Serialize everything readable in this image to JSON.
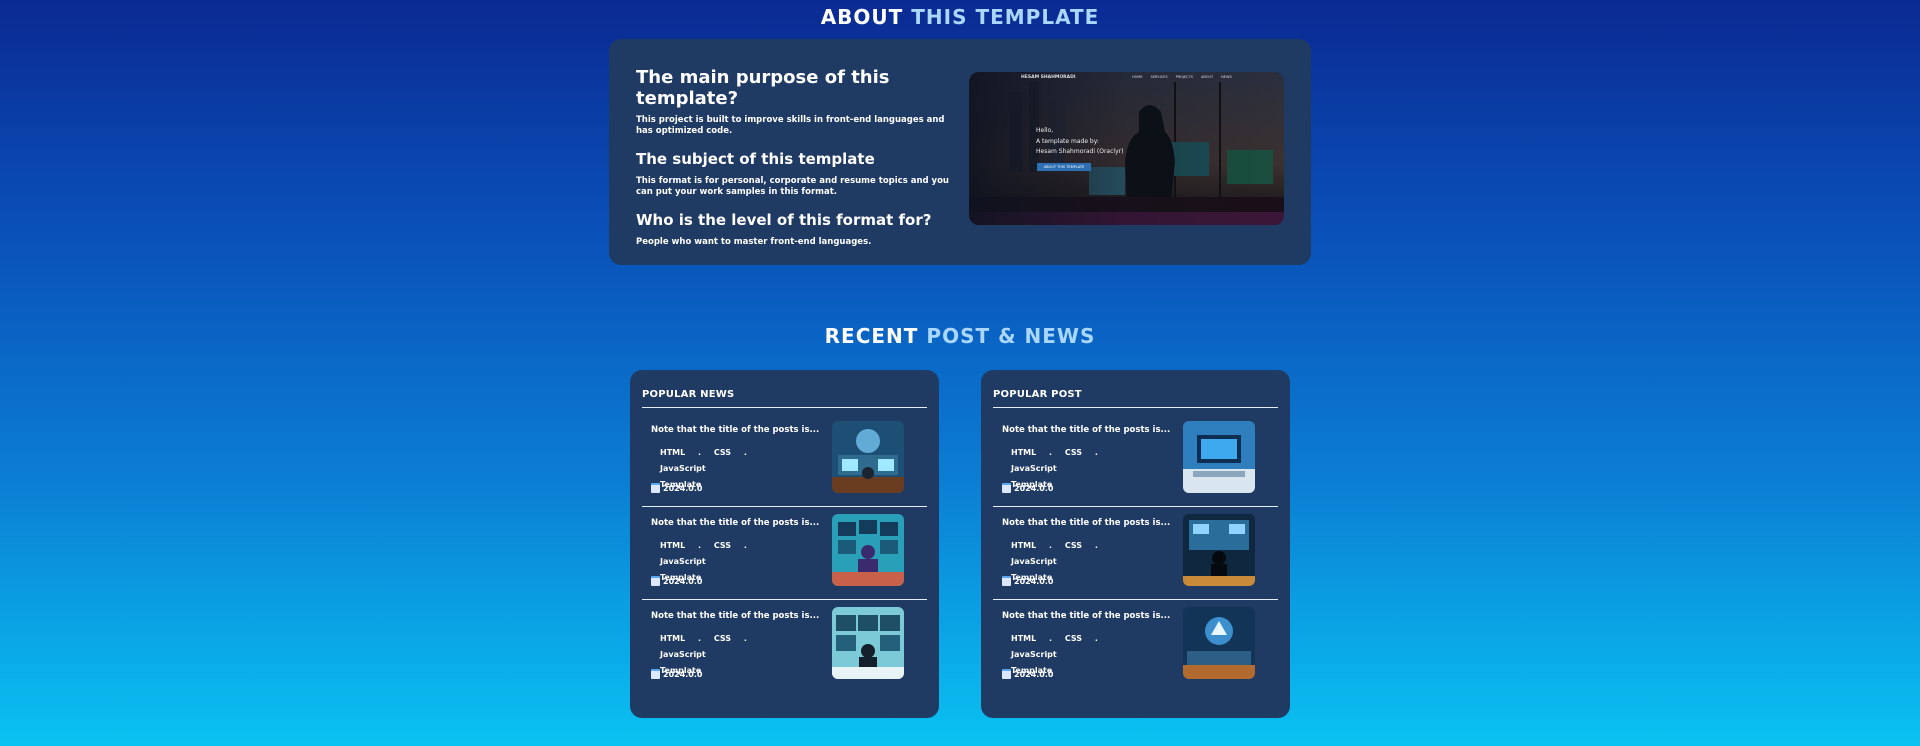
{
  "about": {
    "title_part1": "ABOUT",
    "title_part2": "THIS TEMPLATE",
    "q1": "The main purpose of this template?",
    "a1": "This project is built to improve skills in front-end languages and has optimized code.",
    "q2": "The subject of this template",
    "a2": "This format is for personal, corporate and resume topics and you can put your work samples in this format.",
    "q3": "Who is the level of this format for?",
    "a3": "People who want to master front-end languages.",
    "preview": {
      "brand": "HESAM SHAHMORADI",
      "nav": [
        "HOME",
        "SERVICES",
        "PROJECTS",
        "ABOUT",
        "NEWS"
      ],
      "hello": "Hello,",
      "made_by": "A template made by:",
      "author": "Hesam Shahmoradi (Oraclyr)",
      "button": "ABOUT THIS TEMPLATE"
    }
  },
  "recent": {
    "title_part1": "RECENT",
    "title_part2": "POST & NEWS"
  },
  "news": {
    "title": "POPULAR NEWS",
    "items": [
      {
        "title": "Note that the title of the posts is...",
        "tags": [
          "HTML",
          "CSS",
          "JavaScript"
        ],
        "extra": "Template",
        "date": "2024.0.0"
      },
      {
        "title": "Note that the title of the posts is...",
        "tags": [
          "HTML",
          "CSS",
          "JavaScript"
        ],
        "extra": "Template",
        "date": "2024.0.0"
      },
      {
        "title": "Note that the title of the posts is...",
        "tags": [
          "HTML",
          "CSS",
          "JavaScript"
        ],
        "extra": "Template",
        "date": "2024.0.0"
      }
    ]
  },
  "posts": {
    "title": "POPULAR POST",
    "items": [
      {
        "title": "Note that the title of the posts is...",
        "tags": [
          "HTML",
          "CSS",
          "JavaScript"
        ],
        "extra": "Template",
        "date": "2024.0.0"
      },
      {
        "title": "Note that the title of the posts is...",
        "tags": [
          "HTML",
          "CSS",
          "JavaScript"
        ],
        "extra": "Template",
        "date": "2024.0.0"
      },
      {
        "title": "Note that the title of the posts is...",
        "tags": [
          "HTML",
          "CSS",
          "JavaScript"
        ],
        "extra": "Template",
        "date": "2024.0.0"
      }
    ]
  },
  "tag_separator": ".",
  "icons": {
    "date": "calendar-icon"
  },
  "colors": {
    "card": "#1f3a63",
    "accent_text": "#a9d7ff"
  }
}
